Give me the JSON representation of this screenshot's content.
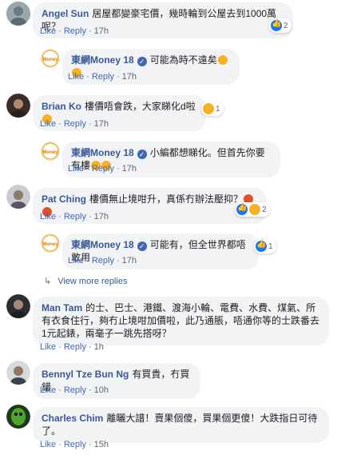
{
  "actions": {
    "like": "Like",
    "reply": "Reply",
    "dot": "·"
  },
  "view_more": "View more replies",
  "comments": [
    {
      "name": "Angel Sun",
      "text": "居屋都變豪宅價，幾時輪到公屋去到1000萬呢？",
      "time": "17h",
      "reactions": "2"
    },
    {
      "name": "東網Money 18",
      "text": "可能為時不遠矣",
      "time": "17h",
      "reactions": ""
    },
    {
      "name": "Brian Ko",
      "text": "樓價唔會跌，大家睇化d啦",
      "time": "17h",
      "reactions": "1"
    },
    {
      "name": "東網Money 18",
      "text": "小編都想睇化。但首先你要有樓",
      "time": "17h",
      "reactions": ""
    },
    {
      "name": "Pat Ching",
      "text": "樓價無止境咁升，真係冇辦法壓抑？",
      "time": "17h",
      "reactions": "2"
    },
    {
      "name": "東網Money 18",
      "text": "可能有，但全世界都唔敢用",
      "time": "17h",
      "reactions": "1"
    },
    {
      "name": "Man Tam",
      "text": "的士、巴士、港鐵、渡海小輪、電費、水費、煤氣、所有衣食住行，夠冇止境咁加價啦，此乃通脹，唔通你等的士跌番去1元起錶，兩毫子一跳先搭呀？",
      "time": "1h",
      "reactions": ""
    },
    {
      "name": "Bennyl Tze Bun Ng",
      "text": "有買貴，冇買錯",
      "time": "10h",
      "reactions": ""
    },
    {
      "name": "Charles Chim",
      "text": "離曬大譜！賣果個傻，買果個更傻！大跌指日可待了。",
      "time": "15h",
      "reactions": ""
    }
  ]
}
